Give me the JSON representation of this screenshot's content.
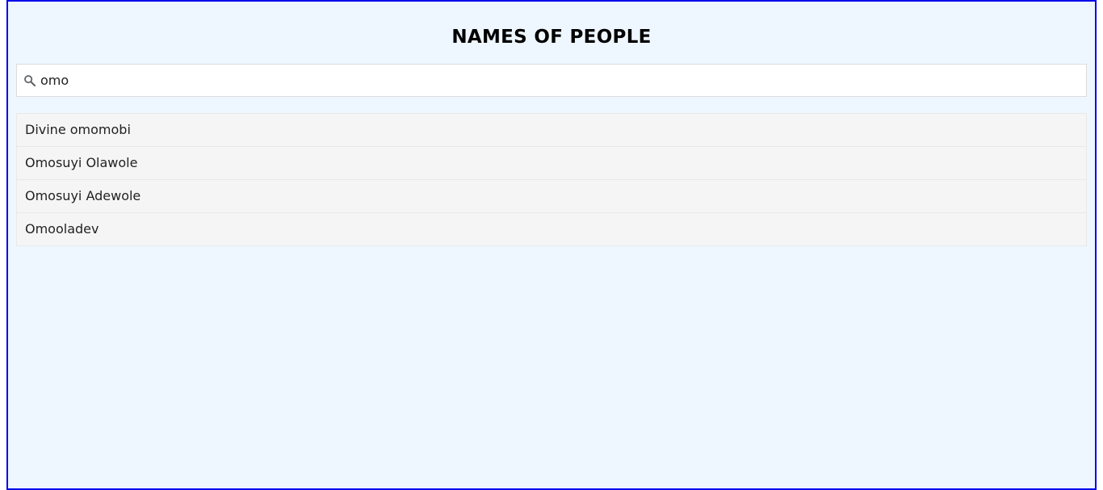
{
  "page": {
    "title": "NAMES OF PEOPLE"
  },
  "search": {
    "value": "omo",
    "icon": "search-icon"
  },
  "results": [
    {
      "name": "Divine omomobi"
    },
    {
      "name": "Omosuyi Olawole"
    },
    {
      "name": "Omosuyi Adewole"
    },
    {
      "name": "Omooladev"
    }
  ],
  "colors": {
    "frame_border": "#0000ee",
    "background": "#eef6ff",
    "item_background": "#f5f5f5"
  }
}
